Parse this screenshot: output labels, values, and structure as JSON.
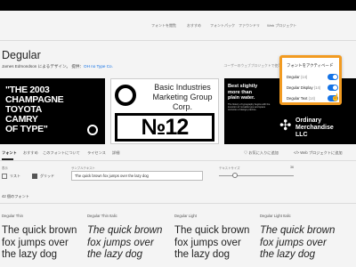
{
  "page": {
    "title": "Degular",
    "byline_prefix": "James Edmondson によるデザイン。 提供：",
    "byline_foundry": "OH no Type Co.",
    "byline_right": "ユーザーのウェブプロジェクトで使用"
  },
  "topbar": {
    "links": [
      "フォントを閲覧",
      "おすすめ",
      "フォントパック",
      "ファウンドリ",
      "Web プロジェクト"
    ]
  },
  "tiles": {
    "t1": [
      "\"THE 2003",
      "CHAMPAGNE",
      "TOYOTA",
      "CAMRY",
      "OF TYPE\""
    ],
    "t2": {
      "sub": "Basic Industries Marketing Group Corp.",
      "big": "№12"
    },
    "t3": {
      "lines": [
        "Best slightly",
        "more than",
        "plain water."
      ],
      "mini": "The history of typography begins with the invention of movable type and spans centuries of design practice.",
      "symbol": "✣",
      "org": [
        "Ordinary",
        "Merchandise",
        "LLC"
      ]
    }
  },
  "tabs": {
    "items": [
      "フォント",
      "おすすめ",
      "このフォントについて",
      "ライセンス",
      "詳細"
    ],
    "favorite": "お気に入りに追加",
    "web_project": "Web プロジェクトに追加"
  },
  "controls": {
    "view_label": "表示",
    "list_label": "リスト",
    "grid_label": "グリッド",
    "sample_label": "サンプルテキスト",
    "sample_value": "The quick brown fox jumps over the lazy dog",
    "size_label": "テキストサイズ",
    "size_value": "36"
  },
  "count_text": "42 個のフォント",
  "fonts": [
    {
      "name": "Degular Thin",
      "sample": "The quick brown fox jumps over the lazy dog",
      "style": "normal",
      "weight": 300
    },
    {
      "name": "Degular Thin Italic",
      "sample": "The quick brown fox jumps over the lazy dog",
      "style": "italic",
      "weight": 300
    },
    {
      "name": "Degular Light",
      "sample": "The quick brown fox jumps over the lazy dog",
      "style": "normal",
      "weight": 400
    },
    {
      "name": "Degular Light Italic",
      "sample": "The quick brown fox jumps over the lazy dog",
      "style": "italic",
      "weight": 400
    }
  ],
  "panel": {
    "header": "フォントをアクティベート",
    "rows": [
      {
        "label": "Degular",
        "count": "(14)",
        "on": true
      },
      {
        "label": "Degular Display",
        "count": "(14)",
        "on": true
      },
      {
        "label": "Degular Text",
        "count": "(14)",
        "on": true
      }
    ]
  },
  "colors": {
    "accent": "#1473e6",
    "highlight": "#f29b21"
  }
}
